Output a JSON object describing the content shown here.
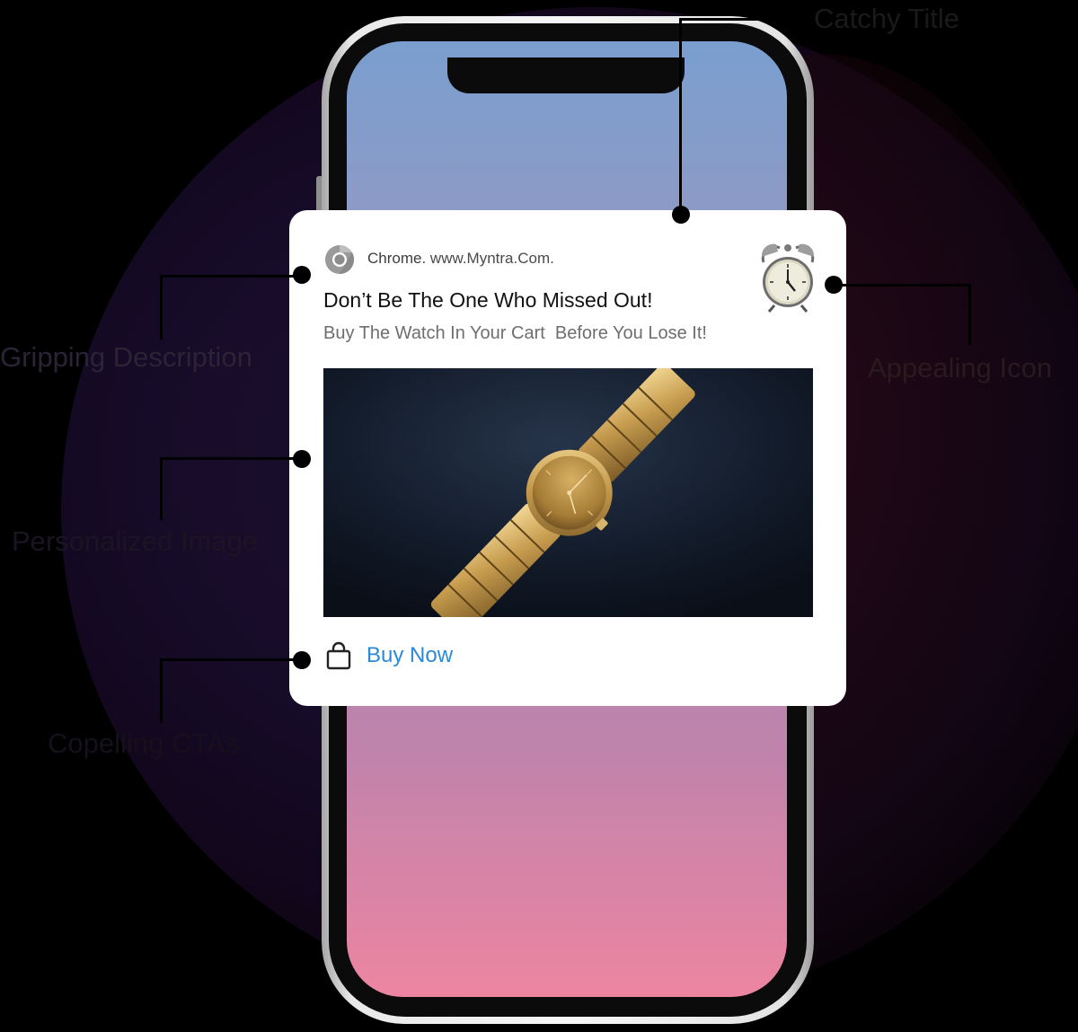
{
  "notification": {
    "app": "Chrome.",
    "url": "www.Myntra.Com.",
    "title": "Don’t Be The One Who Missed Out!",
    "description": "Buy The Watch In Your Cart  Before You Lose It!",
    "cta_label": "Buy Now",
    "app_icon": "chrome-icon",
    "badge_icon": "alarm-clock-icon",
    "cta_icon": "shopping-bag-icon",
    "image": "gold-wristwatch-photo"
  },
  "annotations": {
    "title": "Catchy Title",
    "description": "Gripping Description",
    "icon": "Appealing Icon",
    "image": "Personalized Image",
    "cta": "Copelling CTAs"
  },
  "colors": {
    "cta": "#2a8ad8",
    "screen_top": "#7a9fcf",
    "screen_bottom": "#ed85a1",
    "background": "#000000"
  }
}
